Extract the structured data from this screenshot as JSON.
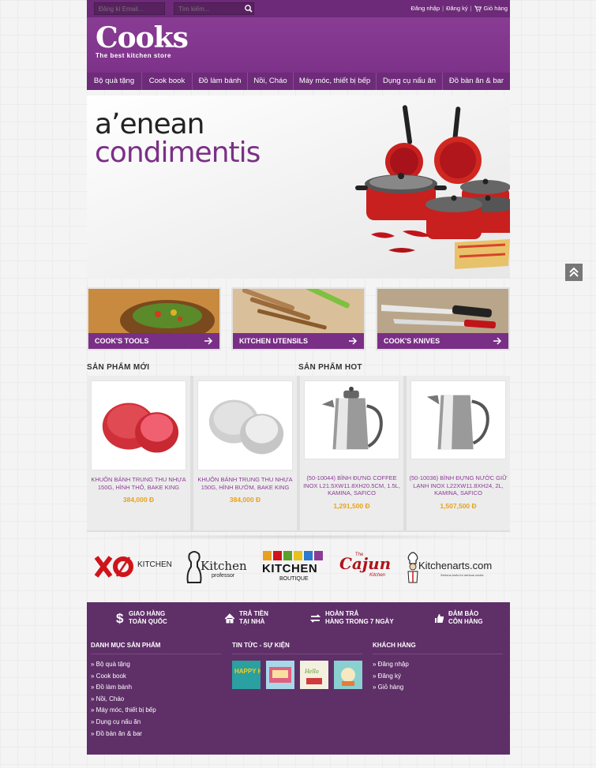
{
  "topbar": {
    "email_placeholder": "Đăng kí Email...",
    "search_placeholder": "Tìm kiếm...",
    "login": "Đăng nhập",
    "register": "Đăng ký",
    "cart": "Giỏ hàng"
  },
  "logo": {
    "word": "Cooks",
    "tagline": "The best kitchen store"
  },
  "nav": [
    "Bộ quà tặng",
    "Cook book",
    "Đồ làm bánh",
    "Nồi, Cháo",
    "Máy móc, thiết bị bếp",
    "Dụng cụ nấu ăn",
    "Đồ bàn ăn & bar"
  ],
  "banner": {
    "line1": "a’enean",
    "line2": "condimentis"
  },
  "categories": [
    "COOK'S TOOLS",
    "KITCHEN UTENSILS",
    "COOK'S KNIVES"
  ],
  "sections": {
    "new": "SẢN PHẨM MỚI",
    "hot": "SẢN PHẨM HOT"
  },
  "products": [
    {
      "name": "KHUÔN BÁNH TRUNG THU NHỰA 150G, HÌNH THỎ, BAKE KING",
      "price": "384,000 Đ"
    },
    {
      "name": "KHUÔN BÁNH TRUNG THU NHỰA 150G, HÌNH BƯỚM, BAKE KING",
      "price": "384,000 Đ"
    },
    {
      "name": "(50-10044) BÌNH ĐỰNG COFFEE INOX L21.5XW11.8XH20.5CM, 1.5L, KAMINA, SAFICO",
      "price": "1,291,500 Đ"
    },
    {
      "name": "(50-10036) BÌNH ĐỰNG NƯỚC GIỮ LẠNH INOX L22XW11.8XH24, 2L, KAMINA, SAFICO",
      "price": "1,507,500 Đ"
    }
  ],
  "brands": {
    "xo": "KITCHEN",
    "professor_main": "Kitchen",
    "professor_sub": "professor",
    "boutique_main": "KITCHEN",
    "boutique_sub": "BOUTIQUE",
    "cajun_the": "The",
    "cajun_main": "Cajun",
    "cajun_sub": "Kitchen",
    "kitchenarts": "Kitchenarts.com",
    "kitchenarts_tag": "Serious tools for serious cooks"
  },
  "services": [
    {
      "l1": "GIAO HÀNG",
      "l2": "TOÀN QUỐC"
    },
    {
      "l1": "TRẢ TIỀN",
      "l2": "TẠI NHÀ"
    },
    {
      "l1": "HOÀN TRẢ",
      "l2": "HÀNG TRONG 7 NGÀY"
    },
    {
      "l1": "ĐẢM BẢO",
      "l2": "CÔN HÀNG"
    }
  ],
  "footer": {
    "catalog_title": "DANH MỤC SẢN PHẨM",
    "catalog": [
      "Bộ quà tặng",
      "Cook book",
      "Đồ làm bánh",
      "Nồi, Cháo",
      "Máy móc, thiết bị bếp",
      "Dụng cụ nấu ăn",
      "Đồ bàn ăn & bar"
    ],
    "news_title": "TIN TỨC - SỰ KIỆN",
    "news_thumb_text": [
      "HAPPY HOUR",
      "",
      "Hello",
      ""
    ],
    "customer_title": "KHÁCH HÀNG",
    "customer": [
      "Đăng nhập",
      "Đăng ký",
      "Giỏ hàng"
    ]
  },
  "colors": {
    "brand_purple": "#7a2f86",
    "price": "#e8a21d",
    "footer": "#5f2f68"
  },
  "icons": [
    "search-icon",
    "cart-icon",
    "arrow-right-icon",
    "dollar-icon",
    "home-icon",
    "return-icon",
    "thumbs-up-icon",
    "chevron-up-icon"
  ]
}
